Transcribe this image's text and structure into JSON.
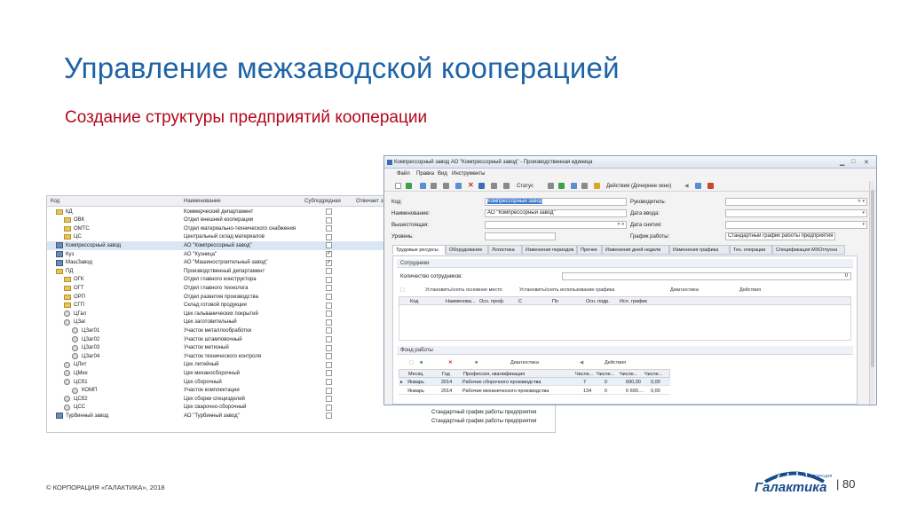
{
  "slide": {
    "title": "Управление межзаводской кооперацией",
    "subtitle": "Создание структуры предприятий кооперации",
    "footer": "© КОРПОРАЦИЯ «ГАЛАКТИКА», 2018",
    "logo_text": "Галактика",
    "logo_small": "КОРПОРАЦИЯ",
    "page_number": "| 80"
  },
  "tree": {
    "headers": [
      "Код",
      "Наименование",
      "Субподрядная",
      "Отвечает за"
    ],
    "rows": [
      {
        "code": "КД",
        "name": "Коммерческий департамент",
        "checked": false,
        "indent": 0,
        "icon": "folder"
      },
      {
        "code": "ОВК",
        "name": "Отдел внешней кооперации",
        "checked": false,
        "indent": 1,
        "icon": "folder"
      },
      {
        "code": "ОМТС",
        "name": "Отдел материально-технического снабжения",
        "checked": false,
        "indent": 1,
        "icon": "folder"
      },
      {
        "code": "ЦС",
        "name": "Центральный склад материалов",
        "checked": false,
        "indent": 1,
        "icon": "folder"
      },
      {
        "code": "Компрессорный завод",
        "name": "АО \"Компрессорный завод\"",
        "checked": false,
        "indent": 0,
        "icon": "factory",
        "selected": true
      },
      {
        "code": "Куз",
        "name": "АО \"Кузница\"",
        "checked": true,
        "indent": 0,
        "icon": "factory"
      },
      {
        "code": "МашЗавод",
        "name": "АО \"Машиностроительный завод\"",
        "checked": true,
        "indent": 0,
        "icon": "factory"
      },
      {
        "code": "ПД",
        "name": "Производственный департамент",
        "checked": false,
        "indent": 0,
        "icon": "folder"
      },
      {
        "code": "ОГК",
        "name": "Отдел главного конструктора",
        "checked": false,
        "indent": 1,
        "icon": "folder"
      },
      {
        "code": "ОГТ",
        "name": "Отдел главного технолога",
        "checked": false,
        "indent": 1,
        "icon": "folder"
      },
      {
        "code": "ОРП",
        "name": "Отдел развития производства",
        "checked": false,
        "indent": 1,
        "icon": "folder"
      },
      {
        "code": "СГП",
        "name": "Склад готовой продукции",
        "checked": false,
        "indent": 1,
        "icon": "folder"
      },
      {
        "code": "ЦГал",
        "name": "Цех гальванических покрытий",
        "checked": false,
        "indent": 1,
        "icon": "gear"
      },
      {
        "code": "ЦЗаг",
        "name": "Цех заготовительный",
        "checked": false,
        "indent": 1,
        "icon": "gear"
      },
      {
        "code": "ЦЗаг01",
        "name": "Участок металлообработки",
        "checked": false,
        "indent": 2,
        "icon": "gear"
      },
      {
        "code": "ЦЗаг02",
        "name": "Участок штамповочный",
        "checked": false,
        "indent": 2,
        "icon": "gear"
      },
      {
        "code": "ЦЗаг03",
        "name": "Участок метизный",
        "checked": false,
        "indent": 2,
        "icon": "gear"
      },
      {
        "code": "ЦЗаг04",
        "name": "Участок технического контроля",
        "checked": false,
        "indent": 2,
        "icon": "gear"
      },
      {
        "code": "ЦЛит",
        "name": "Цех литейный",
        "checked": false,
        "indent": 1,
        "icon": "gear"
      },
      {
        "code": "ЦМех",
        "name": "Цех механосборочный",
        "checked": false,
        "indent": 1,
        "icon": "gear"
      },
      {
        "code": "ЦСб1",
        "name": "Цех сборочный",
        "checked": false,
        "indent": 1,
        "icon": "gear"
      },
      {
        "code": "КОМП",
        "name": "Участок комплектации",
        "checked": false,
        "indent": 2,
        "icon": "gear"
      },
      {
        "code": "ЦСб2",
        "name": "Цех сборки специзделий",
        "checked": false,
        "indent": 1,
        "icon": "gear"
      },
      {
        "code": "ЦСС",
        "name": "Цех сварочно-сборочный",
        "checked": false,
        "indent": 1,
        "icon": "gear"
      },
      {
        "code": "Турбинный завод",
        "name": "АО \"Турбинный завод\"",
        "checked": false,
        "indent": 0,
        "icon": "factory"
      }
    ],
    "extra_rows": [
      "Стандартный график работы предприятия",
      "Стандартный график работы предприятия"
    ]
  },
  "dialog": {
    "title": "Компрессорный завод АО \"Компрессорный завод\" - Производственная единица",
    "menu": [
      "Файл",
      "Правка",
      "Вид",
      "Инструменты"
    ],
    "toolbar_status": "Статус",
    "toolbar_actions": "Действия (Дочернее окно)",
    "fields": {
      "code_label": "Код:",
      "code_value": "Компрессорный завод",
      "name_label": "Наименование:",
      "name_value": "АО \"Компрессорный завод\"",
      "parent_label": "Вышестоящая:",
      "levels_label": "Уровень:",
      "head_label": "Руководитель:",
      "date_in_label": "Дата ввода:",
      "date_out_label": "Дата снятия:",
      "schedule_label": "График работы:",
      "schedule_value": "Стандартный график работы предприятия"
    },
    "tabs": [
      "Трудовые ресурсы",
      "Оборудование",
      "Логистика",
      "Изменения периодов",
      "Прочее",
      "Изменения дней недели",
      "Изменения графика",
      "Тех. операции",
      "Спецификация МХОтпуска"
    ],
    "staff": {
      "group_title": "Сотрудники",
      "count_label": "Количество сотрудников:",
      "count_value": "0",
      "tb_set_main": "Установить/снять основное место",
      "tb_set_schedule": "Установить/снять использование графика",
      "tb_diagnostics": "Диагностика",
      "tb_actions": "Действия",
      "columns": [
        "Код",
        "Наименова...",
        "Осн. проф.",
        "С",
        "По",
        "Осн. подр.",
        "Исп. график"
      ]
    },
    "fund": {
      "group_title": "Фонд работы",
      "tb_diagnostics": "Диагностика",
      "tb_actions": "Действия",
      "columns": [
        "Месяц",
        "Год",
        "Профессия, квалификация",
        "Числе...",
        "Числе...",
        "Числе...",
        "Числе..."
      ],
      "rows": [
        {
          "month": "Январь",
          "year": "2014",
          "profession": "Рабочие сборочного производства",
          "c1": "7",
          "c2": "0",
          "c3": "690,00",
          "c4": "0,00"
        },
        {
          "month": "Январь",
          "year": "2014",
          "profession": "Рабочие механического производства",
          "c1": "134",
          "c2": "0",
          "c3": "6 600....",
          "c4": "0,00"
        }
      ]
    }
  },
  "colors": {
    "title": "#1f63a6",
    "subtitle": "#b3071c",
    "selection": "#dbe6f4"
  }
}
